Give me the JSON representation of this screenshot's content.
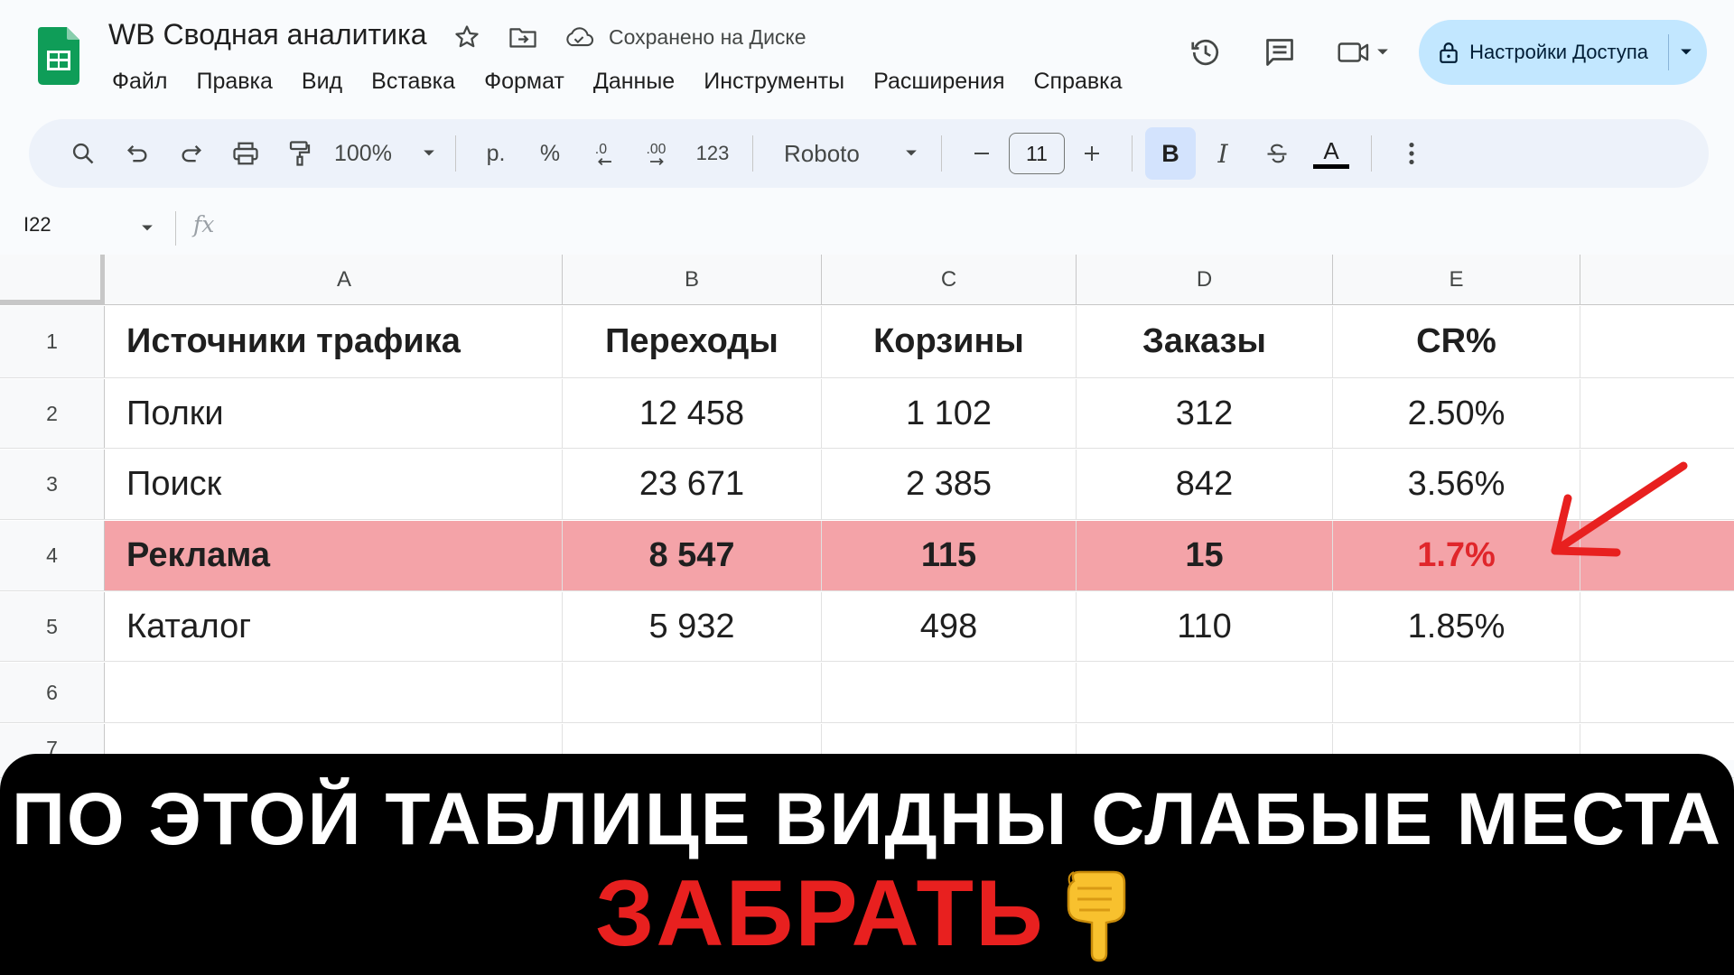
{
  "header": {
    "title": "WB Сводная аналитика",
    "save_status": "Сохранено на Диске",
    "share_label": "Настройки Доступа"
  },
  "menu": [
    "Файл",
    "Правка",
    "Вид",
    "Вставка",
    "Формат",
    "Данные",
    "Инструменты",
    "Расширения",
    "Справка"
  ],
  "toolbar": {
    "zoom": "100%",
    "currency": "р.",
    "percent": "%",
    "number_format": "123",
    "font": "Roboto",
    "font_size": "11",
    "bold": "B",
    "italic": "I",
    "text_color_letter": "A"
  },
  "formula_bar": {
    "cell_ref": "I22",
    "fx": "fx"
  },
  "columns": [
    "A",
    "B",
    "C",
    "D",
    "E"
  ],
  "rows": [
    {
      "num": "1",
      "cells": [
        "Источники трафика",
        "Переходы",
        "Корзины",
        "Заказы",
        "CR%"
      ]
    },
    {
      "num": "2",
      "cells": [
        "Полки",
        "12 458",
        "1 102",
        "312",
        "2.50%"
      ]
    },
    {
      "num": "3",
      "cells": [
        "Поиск",
        "23 671",
        "2 385",
        "842",
        "3.56%"
      ]
    },
    {
      "num": "4",
      "cells": [
        "Реклама",
        "8 547",
        "115",
        "15",
        "1.7%"
      ]
    },
    {
      "num": "5",
      "cells": [
        "Каталог",
        "5 932",
        "498",
        "110",
        "1.85%"
      ]
    },
    {
      "num": "6",
      "cells": [
        "",
        "",
        "",
        "",
        ""
      ]
    },
    {
      "num": "7",
      "cells": [
        "",
        "",
        "",
        "",
        ""
      ]
    }
  ],
  "caption": {
    "line1": "ПО ЭТОЙ ТАБЛИЦЕ ВИДНЫ СЛАБЫЕ МЕСТА",
    "line2": "ЗАБРАТЬ"
  },
  "colors": {
    "highlight_row": "#f4a3a8",
    "alert_red": "#e0262b",
    "cta_red": "#e8201f",
    "share_button": "#c2e7ff"
  }
}
